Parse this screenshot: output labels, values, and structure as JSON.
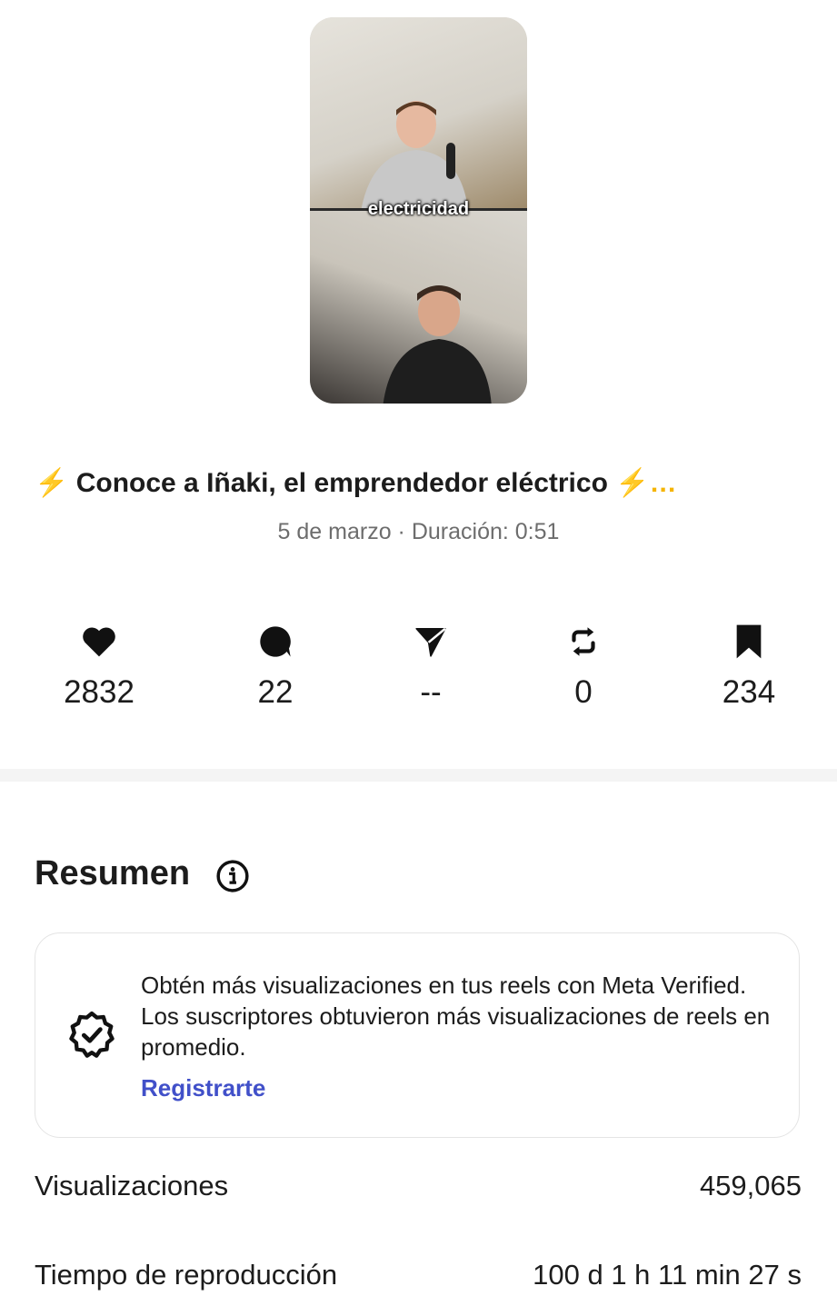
{
  "reel": {
    "caption_overlay": "electricidad",
    "title_prefix": "⚡",
    "title_text": "Conoce a Iñaki, el emprendedor eléctrico",
    "title_suffix": "⚡…",
    "meta": "5 de marzo · Duración: 0:51"
  },
  "stats": [
    {
      "icon": "heart-icon",
      "value": "2832"
    },
    {
      "icon": "comment-icon",
      "value": "22"
    },
    {
      "icon": "send-icon",
      "value": "--"
    },
    {
      "icon": "repost-icon",
      "value": "0"
    },
    {
      "icon": "bookmark-icon",
      "value": "234"
    }
  ],
  "summary": {
    "heading": "Resumen",
    "info_icon": "info-icon",
    "promo": {
      "badge_icon": "verified-badge-icon",
      "text": "Obtén más visualizaciones en tus reels con Meta Verified. Los suscriptores obtuvieron más visualizaciones de reels en promedio.",
      "link": "Registrarte",
      "link_color": "#4150c9"
    },
    "rows": [
      {
        "label": "Visualizaciones",
        "value": "459,065"
      },
      {
        "label": "Tiempo de reproducción",
        "value": "100 d 1 h 11 min 27 s"
      }
    ]
  }
}
